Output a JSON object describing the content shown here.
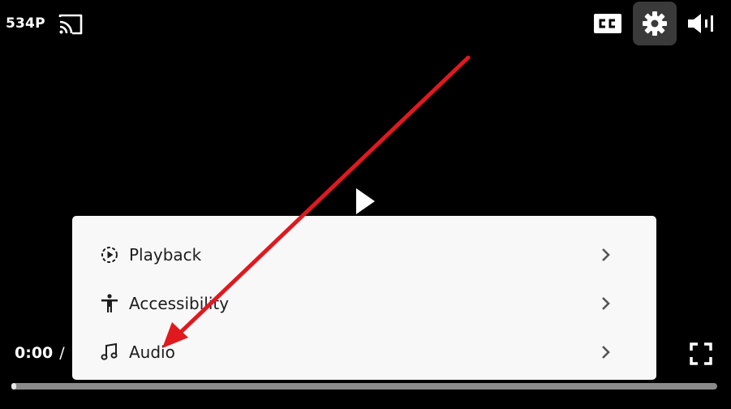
{
  "player": {
    "quality_label": "534P",
    "time_current": "0:00",
    "time_separator": "/",
    "progress_fraction": 0.004,
    "icons": {
      "cast": "cast-icon",
      "captions": "closed-captions-icon",
      "settings": "gear-icon",
      "volume": "volume-icon",
      "play": "play-icon",
      "fullscreen": "fullscreen-icon"
    }
  },
  "settings_menu": {
    "items": [
      {
        "label": "Playback",
        "icon": "playback-speed-icon"
      },
      {
        "label": "Accessibility",
        "icon": "accessibility-icon"
      },
      {
        "label": "Audio",
        "icon": "music-note-icon"
      }
    ]
  },
  "annotation": {
    "arrow_color": "#e0191f"
  }
}
